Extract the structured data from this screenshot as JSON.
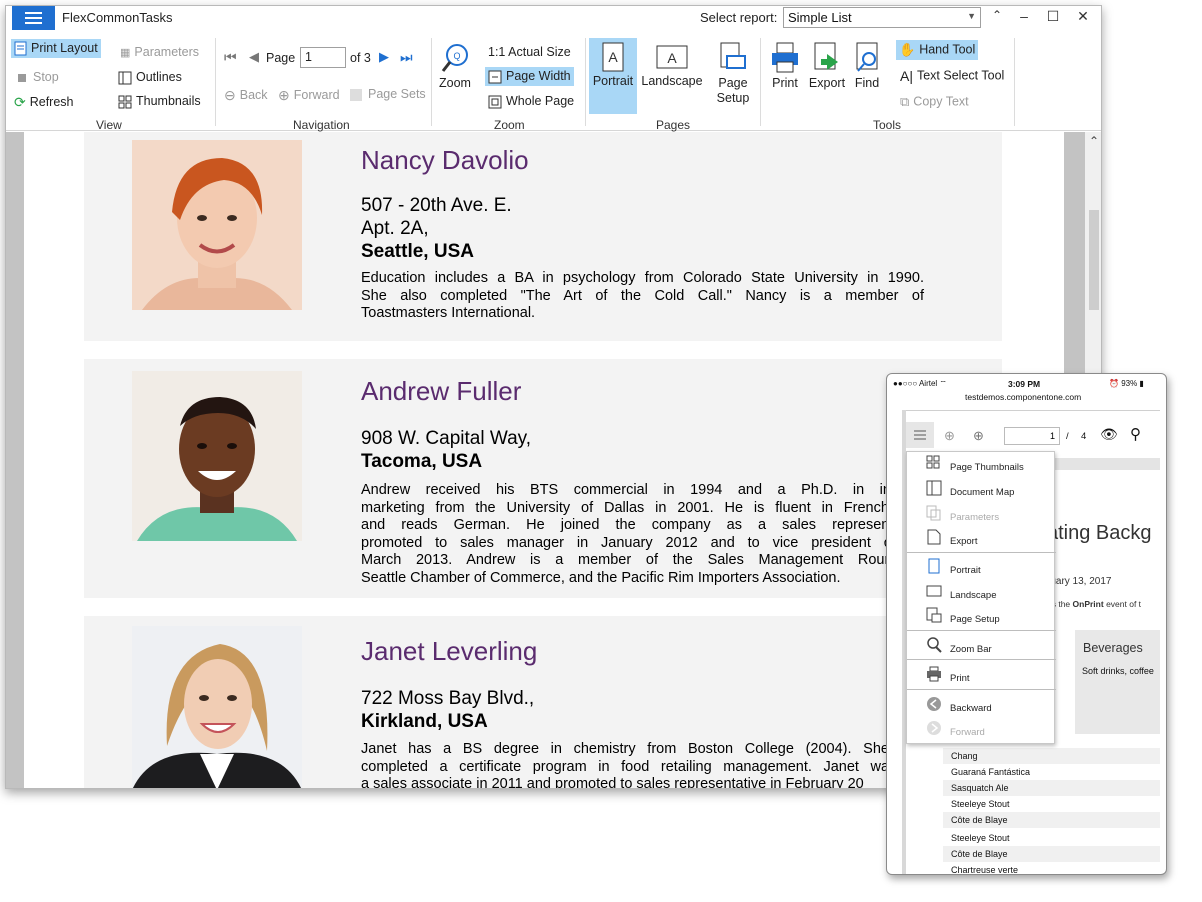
{
  "window": {
    "title": "FlexCommonTasks",
    "select_report_label": "Select report:",
    "select_report_value": "Simple List"
  },
  "ribbon": {
    "view": {
      "print_layout": "Print Layout",
      "stop": "Stop",
      "refresh": "Refresh",
      "parameters": "Parameters",
      "outlines": "Outlines",
      "thumbnails": "Thumbnails",
      "group": "View"
    },
    "navigation": {
      "page_label": "Page",
      "page_value": "1",
      "of_pages": "of 3",
      "back": "Back",
      "forward": "Forward",
      "page_sets": "Page Sets",
      "group": "Navigation"
    },
    "zoom": {
      "zoom": "Zoom",
      "actual_size": "1:1 Actual Size",
      "page_width": "Page Width",
      "whole_page": "Whole Page",
      "group": "Zoom"
    },
    "pages": {
      "portrait": "Portrait",
      "landscape": "Landscape",
      "page_setup_1": "Page",
      "page_setup_2": "Setup",
      "group": "Pages"
    },
    "tools": {
      "print": "Print",
      "export": "Export",
      "find": "Find",
      "hand_tool": "Hand Tool",
      "text_select_tool": "Text Select Tool",
      "copy_text": "Copy Text",
      "group": "Tools"
    }
  },
  "employees": [
    {
      "name": "Nancy Davolio",
      "address": [
        "507 - 20th Ave. E.",
        "Apt. 2A,"
      ],
      "city": "Seattle, USA",
      "bio": [
        "Education includes a BA in psychology from Colorado State University in 1990.",
        "She also completed \"The Art of the Cold Call.\"  Nancy is a member of",
        "Toastmasters International."
      ]
    },
    {
      "name": "Andrew Fuller",
      "address": [
        "908 W. Capital Way,"
      ],
      "city": "Tacoma, USA",
      "bio": [
        "Andrew received his BTS commercial in 1994 and a Ph.D. in interna",
        "marketing from the University of Dallas in 2001.  He is fluent in French and",
        "and reads German.  He joined the company as a sales representative",
        "promoted to sales manager in January 2012 and to vice president of sa",
        "March 2013.  Andrew is a member of the Sales Management Roundtabl",
        "Seattle Chamber of Commerce, and the Pacific Rim Importers Association."
      ]
    },
    {
      "name": "Janet Leverling",
      "address": [
        "722 Moss Bay Blvd.,"
      ],
      "city": "Kirkland, USA",
      "bio": [
        "Janet has a BS degree in chemistry from Boston College (2004).  She has",
        "completed a certificate program in food retailing management.  Janet was hir",
        "a sales associate in 2011 and promoted to sales representative in February 20"
      ]
    }
  ],
  "phone": {
    "carrier": "Airtel",
    "time": "3:09 PM",
    "battery": "93%",
    "url": "testdemos.componentone.com",
    "page_value": "1",
    "page_sep": "/",
    "page_total": "4",
    "menu": [
      "Page Thumbnails",
      "Document Map",
      "Parameters",
      "Export",
      "Portrait",
      "Landscape",
      "Page Setup",
      "Zoom Bar",
      "Print",
      "Backward",
      "Forward"
    ],
    "bg_heading": "ating Backg",
    "bg_date": "ruary 13, 2017",
    "bg_onprint_pre": "es the ",
    "bg_onprint_bold": "OnPrint",
    "bg_onprint_post": " event of t",
    "bg_category": "Beverages",
    "bg_category_desc": "Soft drinks, coffee",
    "products": [
      "Chang",
      "Guaraná Fantástica",
      "Sasquatch Ale",
      "Steeleye Stout",
      "Côte de Blaye",
      "Steeleye Stout",
      "Côte de Blaye",
      "Chartreuse verte"
    ]
  }
}
